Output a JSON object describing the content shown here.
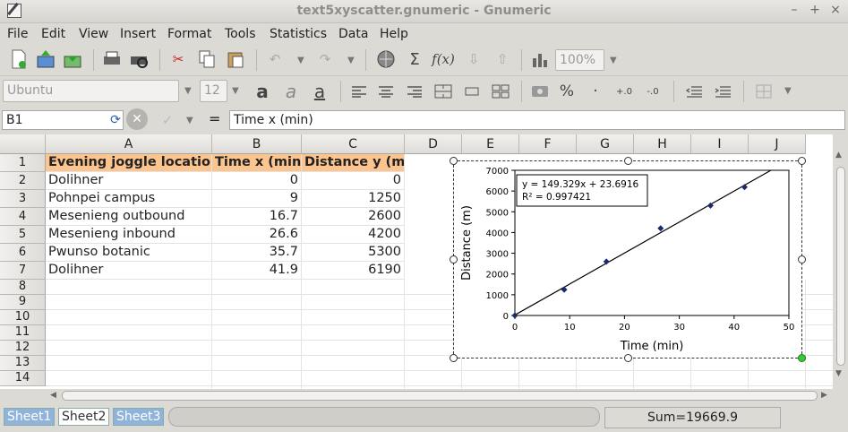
{
  "window": {
    "title": "text5xyscatter.gnumeric - Gnumeric",
    "controls": [
      "–",
      "+",
      "×"
    ]
  },
  "menu": [
    "File",
    "Edit",
    "View",
    "Insert",
    "Format",
    "Tools",
    "Statistics",
    "Data",
    "Help"
  ],
  "toolbar": {
    "zoom": "100%",
    "font_name": "Ubuntu",
    "font_size": "12"
  },
  "formula_bar": {
    "cell_ref": "B1",
    "equals": "=",
    "content": "Time x (min)"
  },
  "columns": [
    "A",
    "B",
    "C",
    "D",
    "E",
    "F",
    "G",
    "H",
    "I",
    "J"
  ],
  "rows": [
    "1",
    "2",
    "3",
    "4",
    "5",
    "6",
    "7",
    "8",
    "9",
    "10",
    "11",
    "12",
    "13",
    "14"
  ],
  "table": {
    "headers": [
      "Evening joggle location",
      "Time x (min)",
      "Distance y (m)"
    ],
    "rows": [
      [
        "Dolihner",
        "0",
        "0"
      ],
      [
        "Pohnpei campus",
        "9",
        "1250"
      ],
      [
        "Mesenieng outbound",
        "16.7",
        "2600"
      ],
      [
        "Mesenieng inbound",
        "26.6",
        "4200"
      ],
      [
        "Pwunso botanic",
        "35.7",
        "5300"
      ],
      [
        "Dolihner",
        "41.9",
        "6190"
      ]
    ]
  },
  "chart_data": {
    "type": "scatter",
    "x": [
      0,
      9,
      16.7,
      26.6,
      35.7,
      41.9
    ],
    "y": [
      0,
      1250,
      2600,
      4200,
      5300,
      6190
    ],
    "xlabel": "Time (min)",
    "ylabel": "Distance (m)",
    "xlim": [
      0,
      50
    ],
    "ylim": [
      0,
      7000
    ],
    "xticks": [
      "0",
      "10",
      "20",
      "30",
      "40",
      "50"
    ],
    "yticks": [
      "0",
      "1000",
      "2000",
      "3000",
      "4000",
      "5000",
      "6000",
      "7000"
    ],
    "trendline": {
      "slope": 149.329,
      "intercept": 23.6916
    },
    "annotation": {
      "equation": "y = 149.329x + 23.6916",
      "r2": "R² = 0.997421"
    },
    "marker_color": "#1a2a6c",
    "grid": false
  },
  "sheets": [
    "Sheet1",
    "Sheet2",
    "Sheet3"
  ],
  "status": {
    "sum": "Sum=19669.9"
  }
}
